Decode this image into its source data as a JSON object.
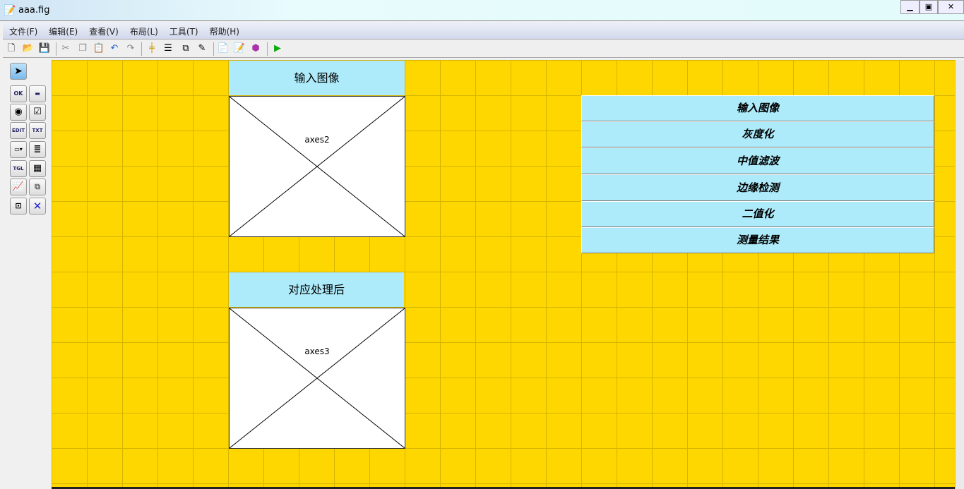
{
  "window": {
    "title": "aaa.fig"
  },
  "menu": [
    "文件(F)",
    "编辑(E)",
    "查看(V)",
    "布局(L)",
    "工具(T)",
    "帮助(H)"
  ],
  "palette": {
    "ok": "OK",
    "edit": "EDIT",
    "txt": "TXT",
    "tgl": "TGL"
  },
  "panels": [
    {
      "title": "输入图像",
      "axes": "axes2"
    },
    {
      "title": "对应处理后",
      "axes": "axes3"
    }
  ],
  "buttons": [
    "输入图像",
    "灰度化",
    "中值滤波",
    "边缘检测",
    "二值化",
    "测量结果"
  ]
}
